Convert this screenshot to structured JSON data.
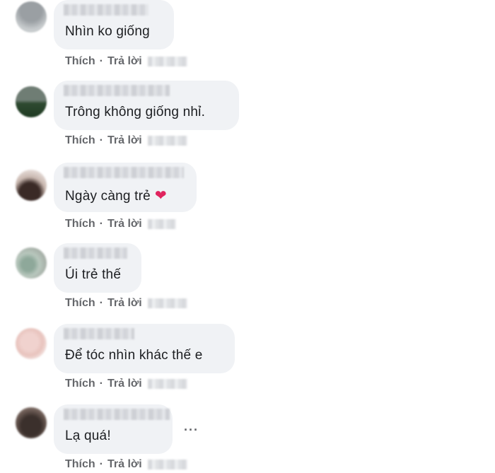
{
  "actions": {
    "like": "Thích",
    "reply": "Trả lời",
    "separator": "·"
  },
  "comments": [
    {
      "text": "Nhìn ko giống"
    },
    {
      "text": "Trông không giống nhỉ."
    },
    {
      "text": "Ngày càng trẻ",
      "emoji": "❤"
    },
    {
      "text": "Úi trẻ thế"
    },
    {
      "text": "Để tóc nhìn khác thế e"
    },
    {
      "text": "Lạ quá!",
      "more": "···"
    }
  ],
  "colors": {
    "bubble": "#f0f2f5",
    "text": "#1c1e21",
    "action": "#65676b",
    "heart": "#e0245e"
  },
  "icons": [
    "heart-emoji",
    "more-options-icon"
  ]
}
